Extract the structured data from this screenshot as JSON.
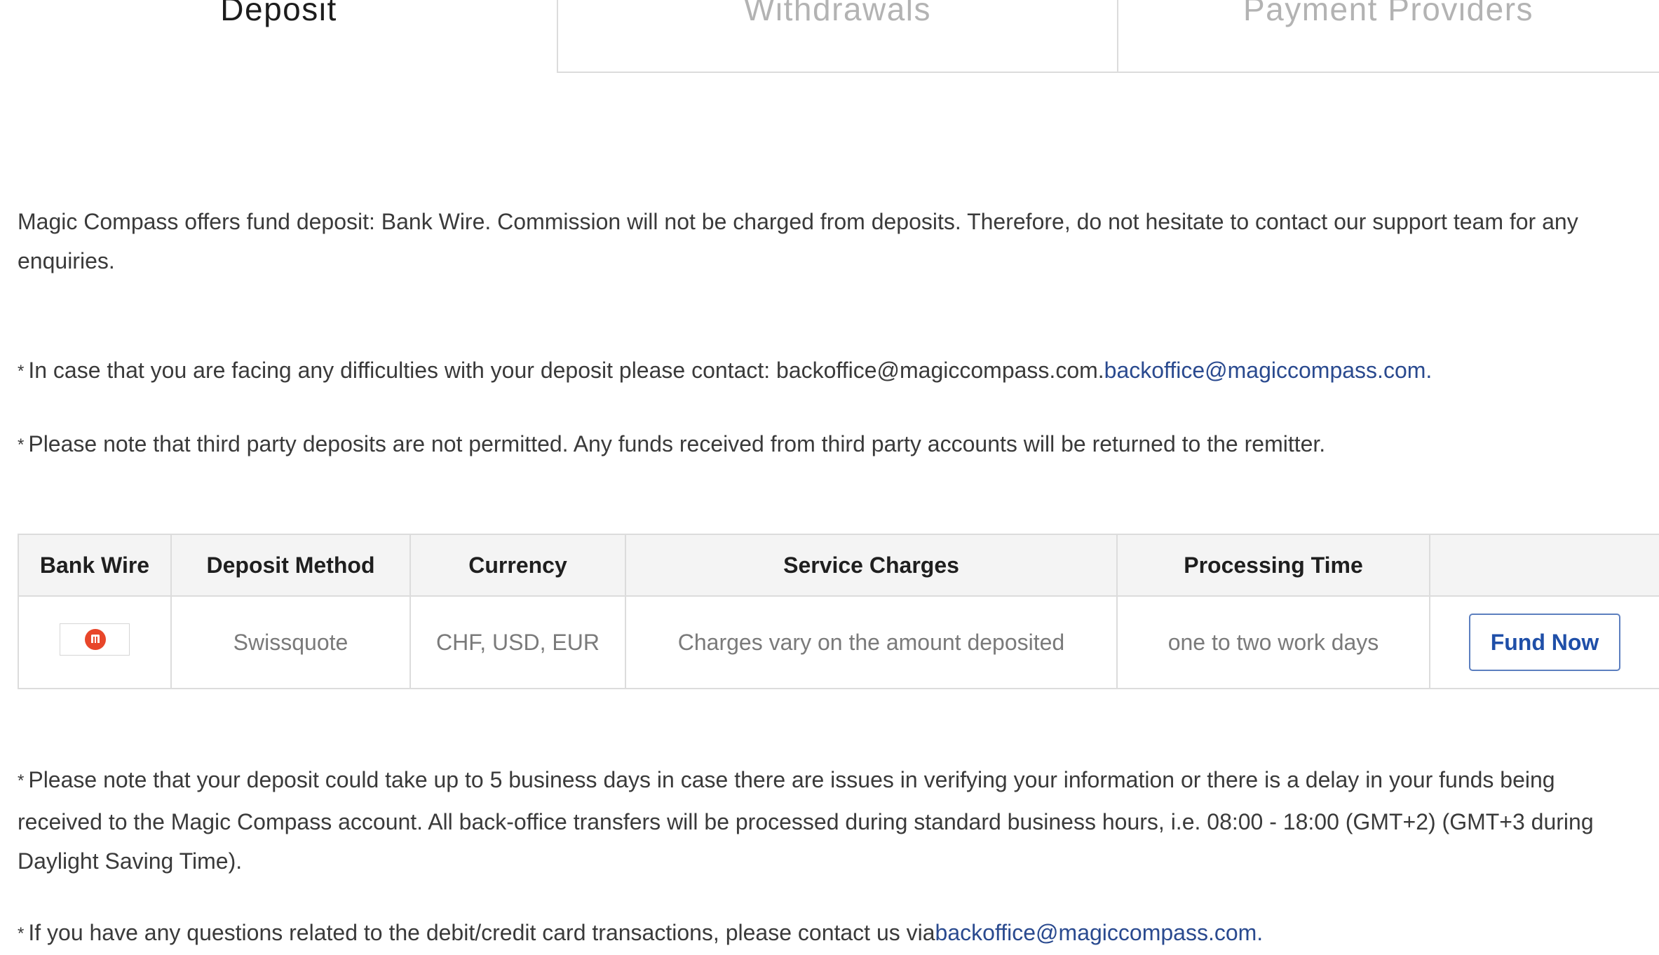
{
  "tabs": [
    {
      "label": "Deposit",
      "active": true
    },
    {
      "label": "Withdrawals",
      "active": false
    },
    {
      "label": "Payment Providers",
      "active": false
    }
  ],
  "intro": "Magic Compass offers fund deposit: Bank Wire. Commission will not be charged from deposits. Therefore, do not hesitate to contact our support team for any enquiries.",
  "note_contact": {
    "star": "*",
    "text": "In case that you are facing any difficulties with your deposit please contact: backoffice@magiccompass.com.",
    "link": "backoffice@magiccompass.com."
  },
  "note_thirdparty": {
    "star": "*",
    "text": "Please note that third party deposits are not permitted. Any funds received from third party accounts will be returned to the remitter."
  },
  "table": {
    "headers": [
      "Bank Wire",
      "Deposit Method",
      "Currency",
      "Service Charges",
      "Processing Time",
      ""
    ],
    "row": {
      "logo_icon": "swissquote-logo-icon",
      "method": "Swissquote",
      "currency": "CHF, USD, EUR",
      "charges": "Charges vary on the amount deposited",
      "time": "one to two work days",
      "button": "Fund Now"
    }
  },
  "note_delay": {
    "star": "*",
    "text": "Please note that your deposit could take up to 5 business days in case there are issues in verifying your information or there is a delay in your funds being received to the Magic Compass account. All back-office transfers will be processed during standard business hours, i.e. 08:00 - 18:00 (GMT+2) (GMT+3 during Daylight Saving Time)."
  },
  "note_card": {
    "star": "*",
    "text": "If you have any questions related to the debit/credit card transactions, please contact us via",
    "link": "backoffice@magiccompass.com."
  },
  "colors": {
    "link": "#2a4a8f",
    "button_text": "#1f4fa8",
    "logo": "#e8462a"
  }
}
